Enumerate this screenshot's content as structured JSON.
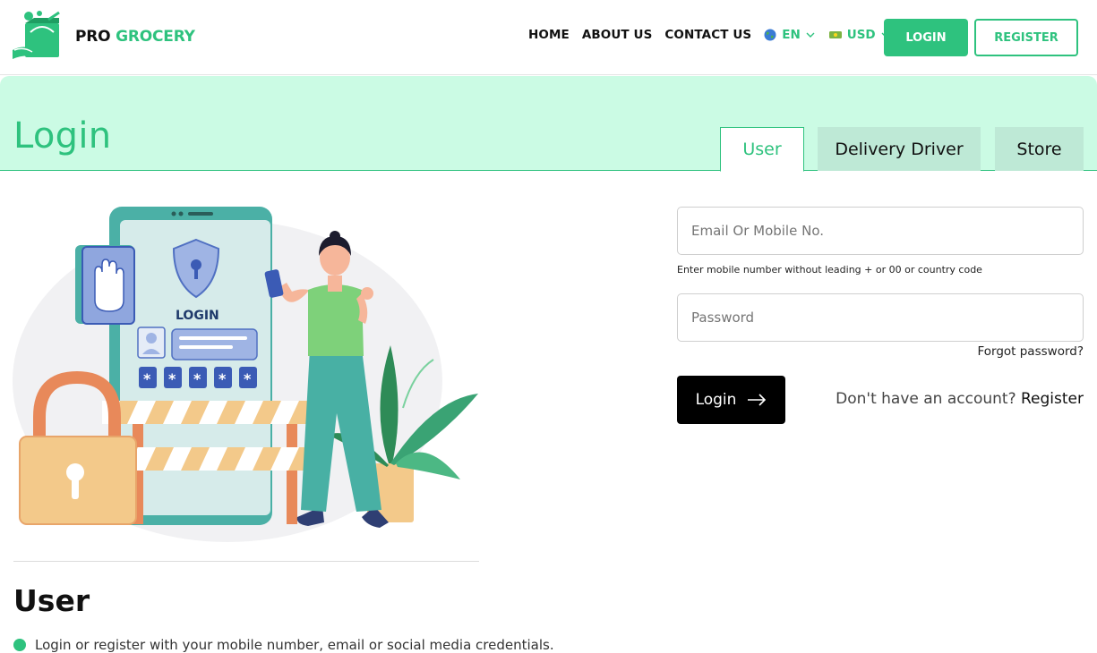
{
  "brand": {
    "word1": "PRO",
    "word2": "GROCERY"
  },
  "nav": {
    "home": "HOME",
    "about": "ABOUT US",
    "contact": "CONTACT US",
    "language": "EN",
    "currency": "USD"
  },
  "header_buttons": {
    "login": "LOGIN",
    "register": "REGISTER"
  },
  "page": {
    "title": "Login"
  },
  "tabs": [
    {
      "label": "User",
      "active": true
    },
    {
      "label": "Delivery Driver",
      "active": false
    },
    {
      "label": "Store",
      "active": false
    }
  ],
  "illustration": {
    "screen_label": "LOGIN"
  },
  "section": {
    "heading": "User",
    "bullet_text": "Login or register with your mobile number, email or social media credentials."
  },
  "form": {
    "email_placeholder": "Email Or Mobile No.",
    "email_hint": "Enter mobile number without leading + or 00 or country code",
    "password_placeholder": "Password",
    "forgot": "Forgot password?",
    "submit": "Login",
    "no_account": "Don't have an account?",
    "register": "Register"
  },
  "colors": {
    "accent": "#2ec27e",
    "banner_bg": "#cbfbe4",
    "tab_inactive": "#bee9d6"
  }
}
